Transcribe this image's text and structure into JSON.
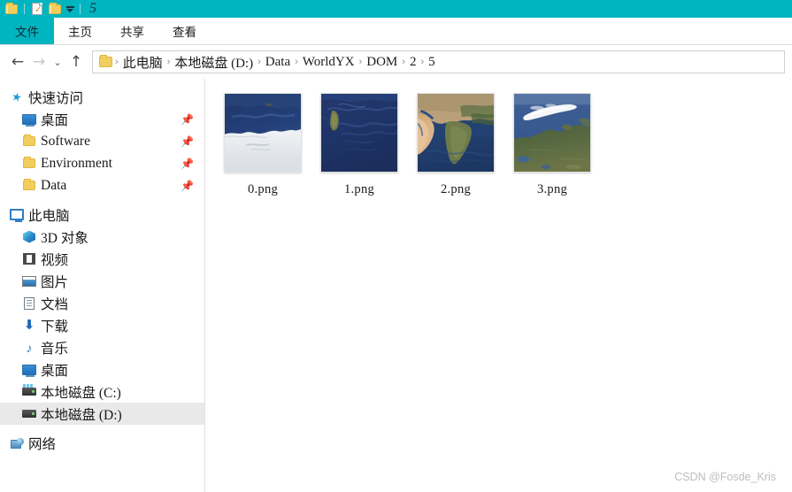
{
  "titlebar": {
    "title": "5",
    "quick_access": [
      {
        "name": "folder-icon",
        "label": "属性"
      },
      {
        "name": "document-check-icon",
        "label": "新建文件夹"
      },
      {
        "name": "folder-icon",
        "label": "打开"
      }
    ],
    "dropdown_label": "自定义快速访问工具栏",
    "accent_color": "#00b4c0"
  },
  "ribbon": {
    "tabs": [
      {
        "label": "文件",
        "active": true
      },
      {
        "label": "主页",
        "active": false
      },
      {
        "label": "共享",
        "active": false
      },
      {
        "label": "查看",
        "active": false
      }
    ]
  },
  "addressbar": {
    "back_label": "←",
    "forward_label": "→",
    "recent_label": "⌄",
    "up_label": "↑",
    "breadcrumb_separator": "›",
    "breadcrumb": [
      "此电脑",
      "本地磁盘 (D:)",
      "Data",
      "WorldYX",
      "DOM",
      "2",
      "5"
    ]
  },
  "sidebar": {
    "sections": [
      {
        "header": {
          "label": "快速访问",
          "icon": "star-pin-icon"
        },
        "items": [
          {
            "label": "桌面",
            "icon": "monitor-icon",
            "pinned": true
          },
          {
            "label": "Software",
            "icon": "folder-icon",
            "pinned": true
          },
          {
            "label": "Environment",
            "icon": "folder-icon",
            "pinned": true
          },
          {
            "label": "Data",
            "icon": "folder-icon",
            "pinned": true
          }
        ]
      },
      {
        "header": {
          "label": "此电脑",
          "icon": "computer-icon"
        },
        "items": [
          {
            "label": "3D 对象",
            "icon": "cube-icon",
            "pinned": false
          },
          {
            "label": "视频",
            "icon": "video-icon",
            "pinned": false
          },
          {
            "label": "图片",
            "icon": "pictures-icon",
            "pinned": false
          },
          {
            "label": "文档",
            "icon": "document-icon",
            "pinned": false
          },
          {
            "label": "下载",
            "icon": "download-icon",
            "pinned": false
          },
          {
            "label": "音乐",
            "icon": "music-icon",
            "pinned": false
          },
          {
            "label": "桌面",
            "icon": "monitor-icon",
            "pinned": false
          },
          {
            "label": "本地磁盘 (C:)",
            "icon": "system-drive-icon",
            "pinned": false
          },
          {
            "label": "本地磁盘 (D:)",
            "icon": "drive-icon",
            "pinned": false,
            "selected": true
          }
        ]
      },
      {
        "header": {
          "label": "网络",
          "icon": "network-icon"
        },
        "items": []
      }
    ],
    "pin_glyph": "📌",
    "selected_item": "本地磁盘 (D:)"
  },
  "content": {
    "view_mode": "大图标",
    "files": [
      {
        "name": "0.png",
        "thumbnail": "antarctic-coast-satellite"
      },
      {
        "name": "1.png",
        "thumbnail": "indian-ocean-madagascar-satellite"
      },
      {
        "name": "2.png",
        "thumbnail": "india-arabia-satellite"
      },
      {
        "name": "3.png",
        "thumbnail": "siberia-kara-sea-satellite"
      }
    ]
  },
  "watermark": {
    "text": "CSDN @Fosde_Kris"
  }
}
